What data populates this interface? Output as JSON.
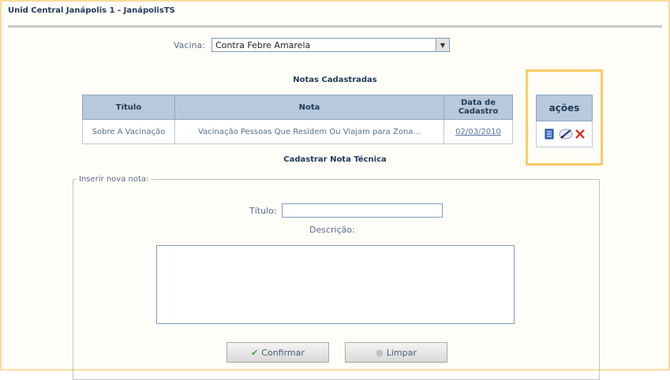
{
  "header": {
    "title": "Unid Central Janápolis 1 - JanápolisTS"
  },
  "filter": {
    "vacina_label": "Vacina:",
    "vacina_selected": "Contra Febre Amarela"
  },
  "notas": {
    "title": "Notas Cadastradas",
    "columns": [
      "Título",
      "Nota",
      "Data de Cadastro"
    ],
    "rows": [
      {
        "titulo": "Sobre A Vacinação",
        "nota": "Vacinação Pessoas Que Residem Ou Viajam para Zona...",
        "data": "02/03/2010"
      }
    ]
  },
  "acoes": {
    "header": "ações",
    "icons": [
      "document-icon",
      "edit-pen-icon",
      "delete-x-icon"
    ]
  },
  "form": {
    "title": "Cadastrar Nota Técnica",
    "legend": "Inserir nova nota:",
    "titulo_label": "Título:",
    "titulo_value": "",
    "descricao_label": "Descrição:",
    "descricao_value": "",
    "confirmar_label": "Confirmar",
    "limpar_label": "Limpar"
  },
  "colors": {
    "accent_frame": "#f6dc9c",
    "acoes_highlight": "#f8cc65",
    "table_header": "#b8c9dc"
  }
}
